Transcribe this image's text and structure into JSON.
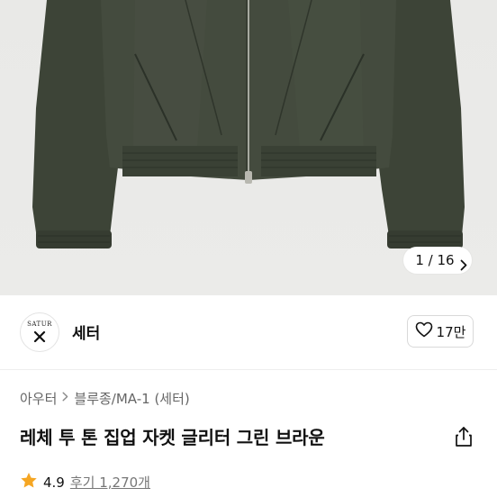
{
  "gallery": {
    "counter": "1 / 16",
    "next_icon": "chevron-right-icon"
  },
  "brand": {
    "logo_text": "SATUR",
    "name": "세터"
  },
  "like": {
    "icon": "heart-outline-icon",
    "count": "17만"
  },
  "breadcrumb": {
    "items": [
      "아우터",
      "블루종/MA-1 (세터)"
    ],
    "separator_icon": "chevron-right-icon"
  },
  "product": {
    "title": "레체 투 톤 집업 자켓 글리터 그린 브라운",
    "share_icon": "share-icon"
  },
  "rating": {
    "star_icon": "star-icon",
    "star_color": "#f5a623",
    "score": "4.9",
    "reviews": "후기 1,270개"
  }
}
